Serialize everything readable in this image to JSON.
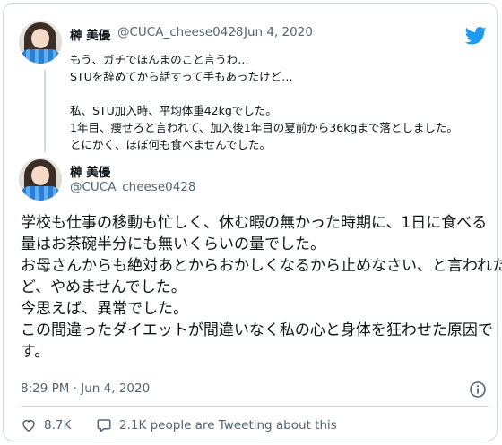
{
  "quoted_tweet": {
    "author_name": "榊 美優",
    "handle": "@CUCA_cheese0428",
    "separator": "·",
    "date": "Jun 4, 2020",
    "lines": [
      "もう、ガチでほんまのこと言うわ…",
      "STUを辞めてから話すって手もあったけど…",
      "",
      "私、STU加入時、平均体重42kgでした。",
      "1年目、痩せろと言われて、加入後1年目の夏前から36kgまで落としました。",
      "とにかく、ほぼ何も食べませんでした。"
    ]
  },
  "main_tweet": {
    "author_name": "榊 美優",
    "handle": "@CUCA_cheese0428",
    "lines": [
      "学校も仕事の移動も忙しく、休む暇の無かった時期に、1日に食べる",
      "量はお茶碗半分にも無いくらいの量でした。",
      "お母さんからも絶対あとからおかしくなるから止めなさい、と言われたけ",
      "ど、やめませんでした。",
      "今思えば、異常でした。",
      "この間違ったダイエットが間違いなく私の心と身体を狂わせた原因で",
      "す。"
    ],
    "timestamp": "8:29 PM · Jun 4, 2020"
  },
  "actions": {
    "like_count": "8.7K",
    "retweet_text": "2.1K people are Tweeting about this"
  },
  "icons": {
    "brand": "twitter-bird-icon",
    "info": "info-icon",
    "like": "heart-icon",
    "comment": "speech-bubble-icon"
  },
  "colors": {
    "twitter_blue": "#1d9bf0",
    "text": "#0f1419",
    "secondary": "#536471",
    "border": "#cfd9de"
  }
}
